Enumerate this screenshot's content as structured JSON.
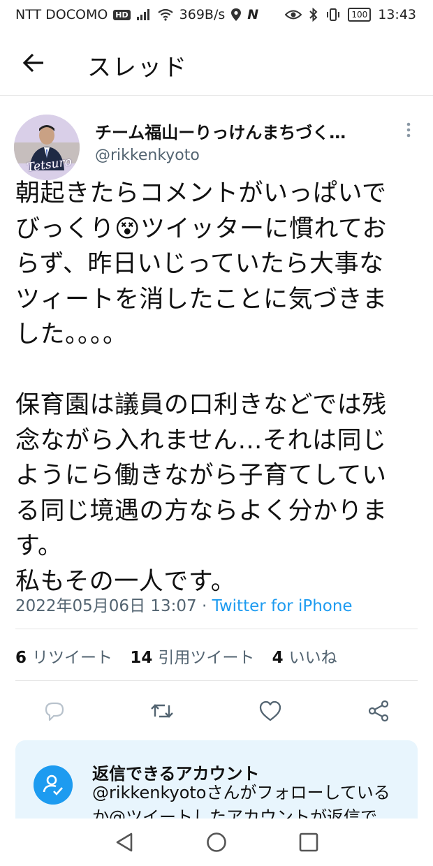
{
  "status_bar": {
    "carrier": "NTT DOCOMO",
    "hd_badge": "HD",
    "speed": "369B/s",
    "n_label": "N",
    "battery": "100",
    "time": "13:43"
  },
  "header": {
    "title": "スレッド"
  },
  "tweet": {
    "avatar_text": "Tetsuro",
    "display_name": "チーム福山ーりっけんまちづく…",
    "handle": "@rikkenkyoto",
    "text": "朝起きたらコメントがいっぱいで\nびっくり😵ツイッターに慣れてお\nらず、昨日いじっていたら大事な\nツィートを消したことに気づきま\nした。。。。\n\n保育園は議員の口利きなどでは残\n念ながら入れません…それは同じ\nようにら働きながら子育てしてい\nる同じ境遇の方ならよく分かりま\nす。\n私もその一人です。",
    "timestamp": "2022年05月06日 13:07",
    "separator": "·",
    "source": "Twitter for iPhone"
  },
  "stats": {
    "retweets_count": "6",
    "retweets_label": "リツイート",
    "quotes_count": "14",
    "quotes_label": "引用ツイート",
    "likes_count": "4",
    "likes_label": "いいね"
  },
  "actions": {
    "icons": [
      "reply-icon",
      "retweet-icon",
      "like-icon",
      "share-icon"
    ]
  },
  "reply_notice": {
    "title": "返信できるアカウント",
    "body": "@rikkenkyotoさんがフォローしている\nか@ツイートしたアカウントが返信で"
  },
  "colors": {
    "accent": "#1d9bf0",
    "muted": "#536471",
    "notice_bg": "#e8f5fd"
  }
}
